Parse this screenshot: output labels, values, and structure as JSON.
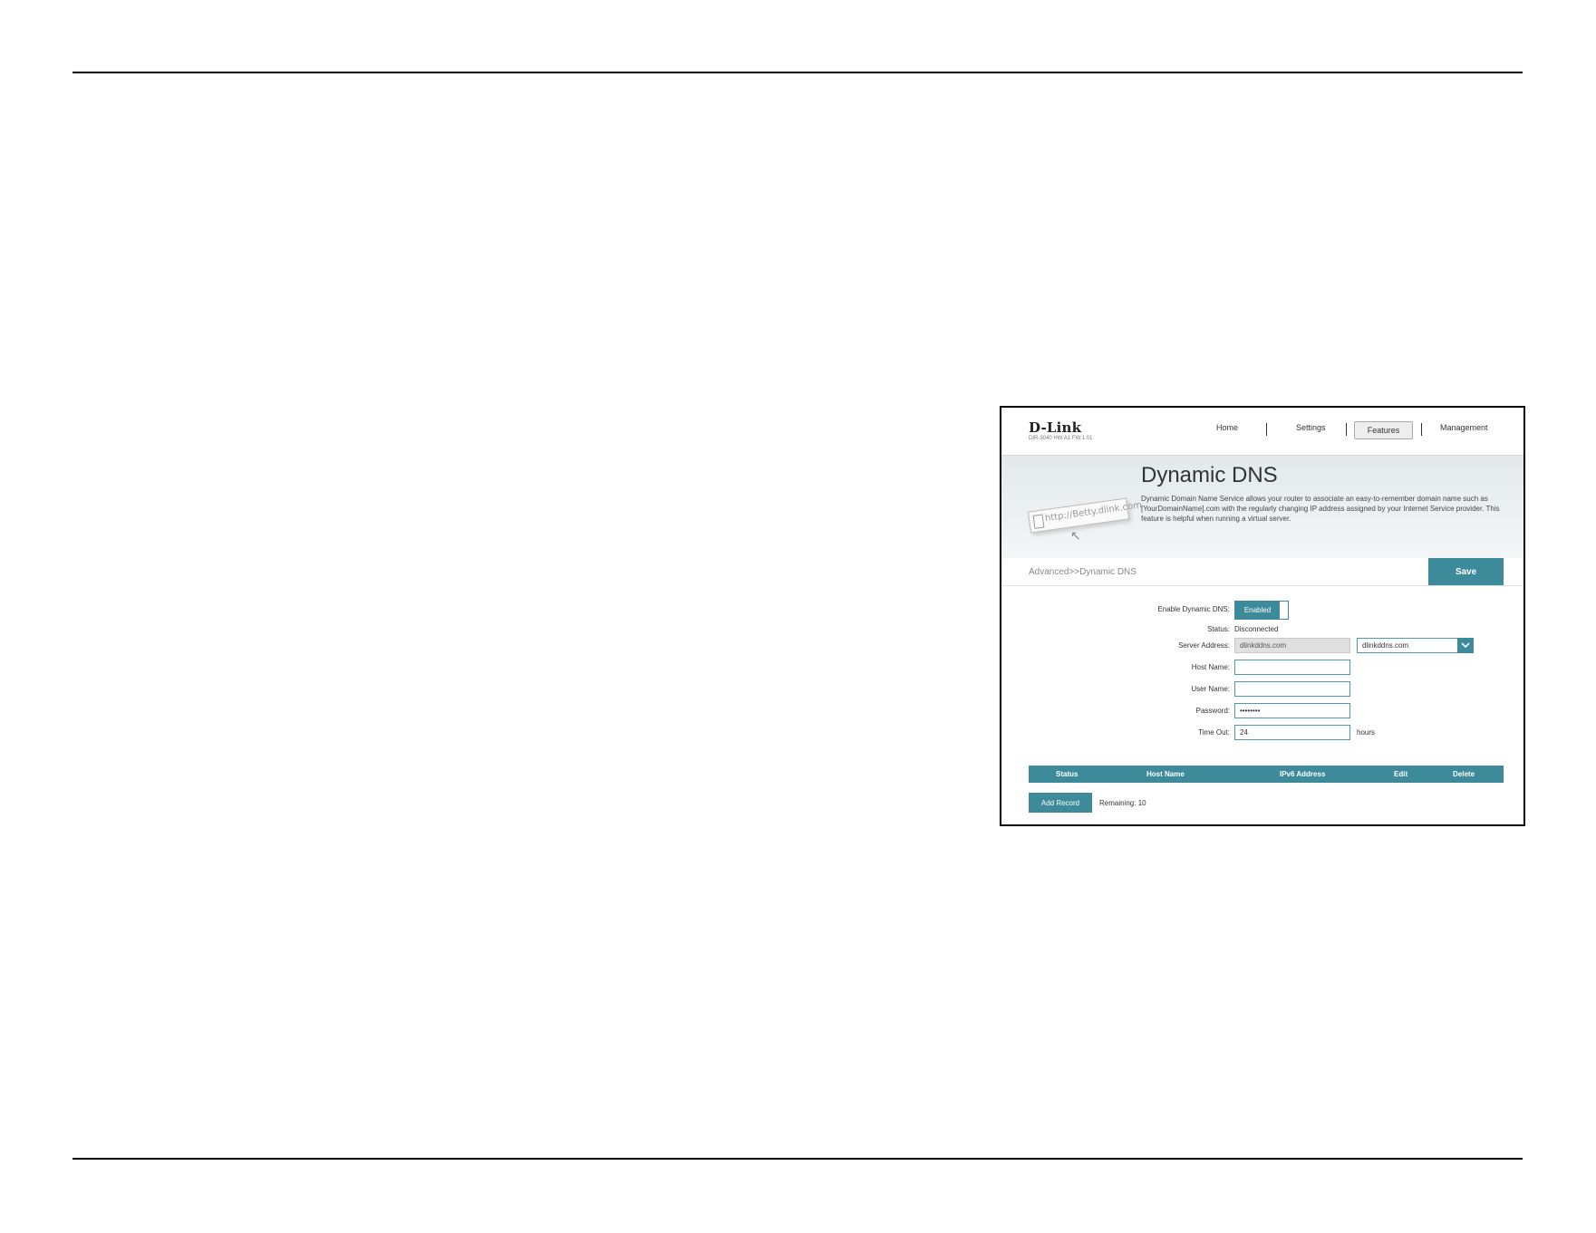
{
  "header": {
    "logo": "D-Link",
    "model": "DIR-3040 HW:A1 FW:1.01",
    "nav": [
      "Home",
      "Settings",
      "Features",
      "Management"
    ]
  },
  "banner": {
    "title": "Dynamic DNS",
    "description": "Dynamic Domain Name Service allows your router to associate an easy-to-remember domain name such as [YourDomainName].com with the regularly changing IP address assigned by your Internet Service provider. This feature is helpful when running a virtual server.",
    "url_art_text": "http://Betty.dlink.com"
  },
  "breadcrumb": "Advanced>>Dynamic DNS",
  "save_label": "Save",
  "form": {
    "enable_label": "Enable Dynamic DNS:",
    "enable_value": "Enabled",
    "status_label": "Status:",
    "status_value": "Disconnected",
    "server_label": "Server Address:",
    "server_value": "dlinkddns.com",
    "server_select": "dlinkddns.com",
    "host_label": "Host Name:",
    "host_value": "",
    "user_label": "User Name:",
    "user_value": "",
    "password_label": "Password:",
    "password_value": "••••••••",
    "timeout_label": "Time Out:",
    "timeout_value": "24",
    "timeout_unit": "hours"
  },
  "table": {
    "columns": [
      "Status",
      "Host Name",
      "IPv6 Address",
      "Edit",
      "Delete"
    ]
  },
  "add_record_label": "Add Record",
  "remaining_text": "Remaining: 10",
  "colors": {
    "accent": "#3d8a9b"
  }
}
